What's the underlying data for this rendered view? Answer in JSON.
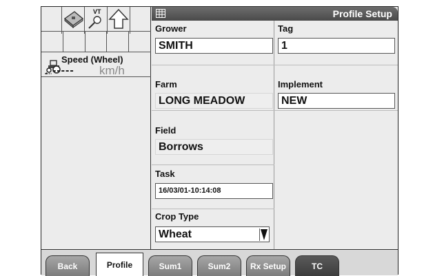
{
  "left_panel": {
    "icons": [
      "book-icon",
      "magnifier-icon",
      "vt-label-icon",
      "up-arrow-icon"
    ],
    "vt_label": "VT",
    "speed": {
      "label": "Speed (Wheel)",
      "value": "-----",
      "unit": "km/h"
    }
  },
  "header": {
    "title": "Profile Setup"
  },
  "form": {
    "grower": {
      "label": "Grower",
      "value": "SMITH"
    },
    "tag": {
      "label": "Tag",
      "value": "1"
    },
    "farm": {
      "label": "Farm",
      "value": "LONG MEADOW"
    },
    "implement": {
      "label": "Implement",
      "value": "NEW"
    },
    "field": {
      "label": "Field",
      "value": "Borrows"
    },
    "task": {
      "label": "Task",
      "value": "16/03/01-10:14:08"
    },
    "crop_type": {
      "label": "Crop Type",
      "value": "Wheat"
    }
  },
  "tabs": [
    {
      "label": "Back"
    },
    {
      "label": "Profile"
    },
    {
      "label": "Sum1"
    },
    {
      "label": "Sum2"
    },
    {
      "label": "Rx Setup"
    },
    {
      "label": "TC"
    }
  ],
  "colors": {
    "title_bar": "#5a5a5a",
    "tab": "#8f8f8f",
    "active_tab": "#ffffff"
  }
}
